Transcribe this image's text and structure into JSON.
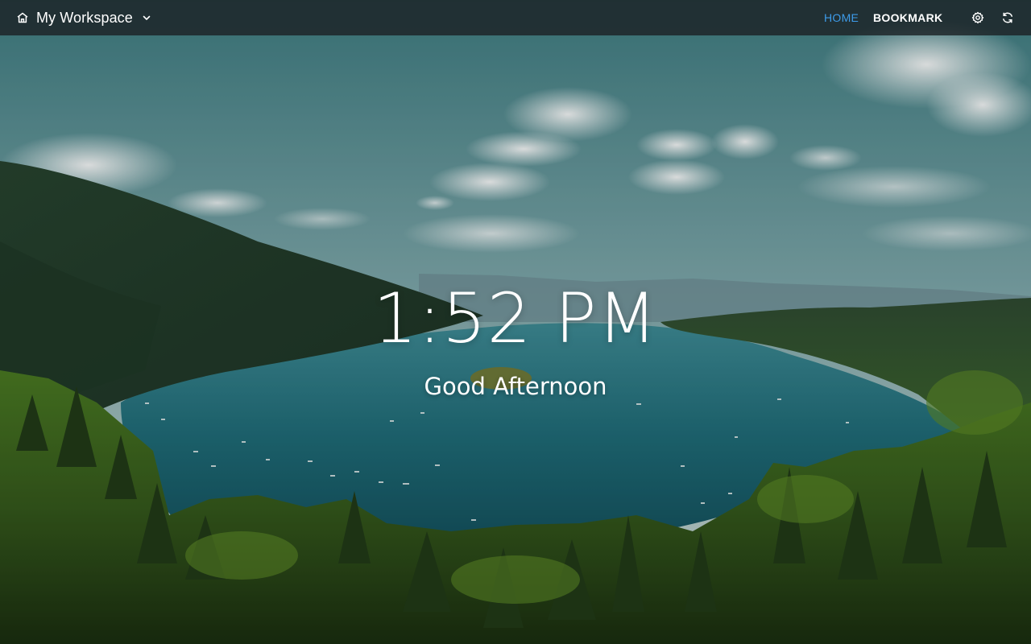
{
  "header": {
    "workspace_name": "My Workspace",
    "workspace_icon": "home-icon",
    "dropdown_icon": "chevron-down-icon",
    "nav": {
      "home_label": "HOME",
      "bookmark_label": "BOOKMARK",
      "active": "HOME"
    },
    "settings_icon": "gear-icon",
    "refresh_icon": "refresh-icon"
  },
  "main": {
    "time": "1:52 PM",
    "greeting": "Good Afternoon"
  },
  "background": {
    "description_icon": "landscape-wallpaper"
  },
  "colors": {
    "accent": "#3d9be9",
    "topbar": "#1c2226",
    "text": "#ffffff"
  }
}
